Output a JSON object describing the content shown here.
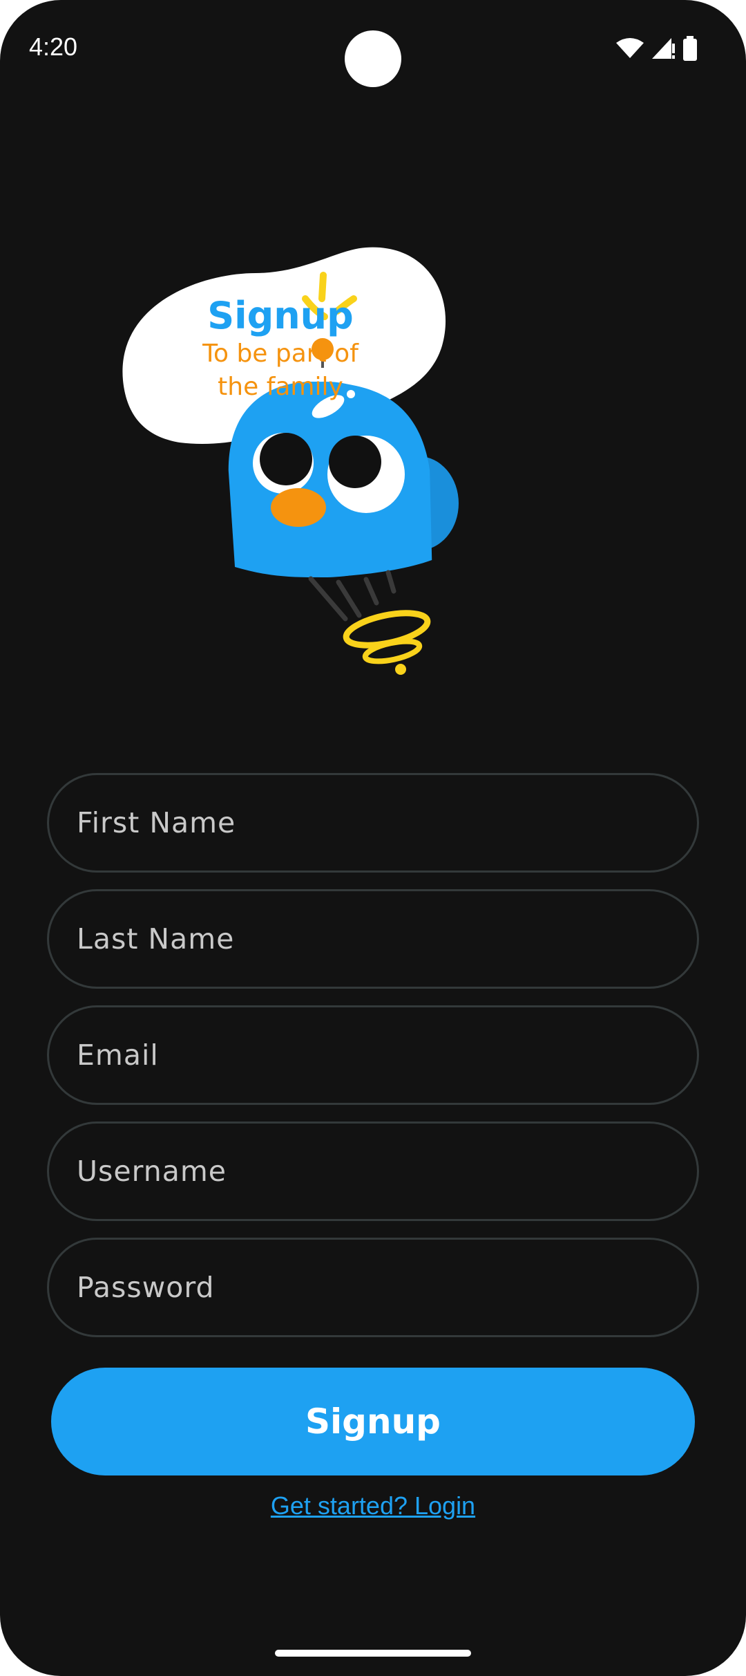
{
  "status_bar": {
    "time": "4:20",
    "icons": [
      "wifi-icon",
      "cellular-signal-icon",
      "battery-icon"
    ]
  },
  "header": {
    "title": "Signup",
    "subtitle_line1": "To be part of",
    "subtitle_line2": "the family"
  },
  "form": {
    "first_name": {
      "placeholder": "First Name",
      "value": ""
    },
    "last_name": {
      "placeholder": "Last Name",
      "value": ""
    },
    "email": {
      "placeholder": "Email",
      "value": ""
    },
    "username": {
      "placeholder": "Username",
      "value": ""
    },
    "password": {
      "placeholder": "Password",
      "value": ""
    },
    "submit_label": "Signup",
    "login_link": "Get started? Login"
  },
  "colors": {
    "background": "#121212",
    "accent": "#1ea1f2",
    "subtitle": "#f5930f",
    "field_border": "#33393a"
  }
}
